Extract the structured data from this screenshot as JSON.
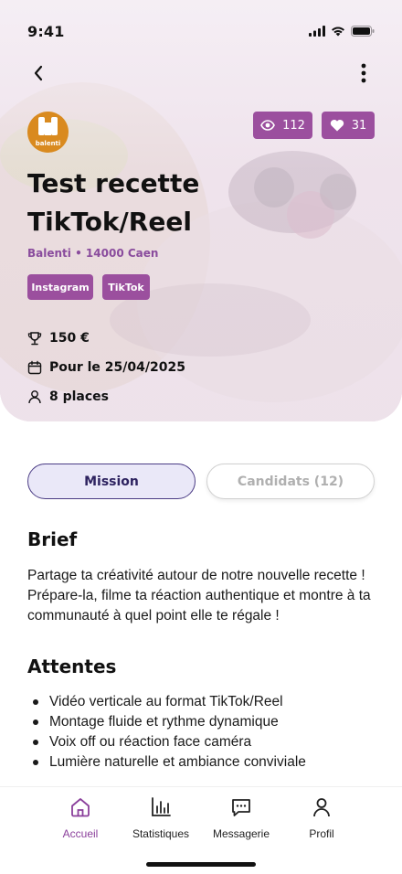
{
  "status_bar": {
    "time": "9:41"
  },
  "header": {
    "back_icon": "chevron-left-icon",
    "more_icon": "more-vertical-icon"
  },
  "brand": {
    "logo_text": "balenti"
  },
  "stats": {
    "views": "112",
    "likes": "31"
  },
  "campaign": {
    "title": "Test recette TikTok/Reel",
    "subtitle": "Balenti • 14000 Caen",
    "tags": [
      "Instagram",
      "TikTok"
    ],
    "prize": "150 €",
    "deadline": "Pour le 25/04/2025",
    "places": "8 places"
  },
  "tabs": {
    "mission": "Mission",
    "candidates": "Candidats (12)",
    "active": "mission"
  },
  "brief": {
    "title": "Brief",
    "text": "Partage ta créativité autour de notre nouvelle recette ! Prépare-la, filme ta réaction authentique et montre à ta communauté à quel point elle te régale !"
  },
  "attentes": {
    "title": "Attentes",
    "items": [
      "Vidéo verticale au format TikTok/Reel",
      "Montage fluide et rythme dynamique",
      "Voix off ou réaction face caméra",
      "Lumière naturelle et ambiance conviviale"
    ]
  },
  "bottom_nav": {
    "items": [
      {
        "label": "Accueil",
        "icon": "home-icon"
      },
      {
        "label": "Statistiques",
        "icon": "bar-chart-icon"
      },
      {
        "label": "Messagerie",
        "icon": "message-icon"
      },
      {
        "label": "Profil",
        "icon": "user-icon"
      }
    ],
    "active": "Accueil"
  },
  "colors": {
    "accent": "#9b4f9e",
    "tab_active_bg": "#eae8f8",
    "tab_active_border": "#4b3c85",
    "logo_bg": "#d98a1f"
  }
}
